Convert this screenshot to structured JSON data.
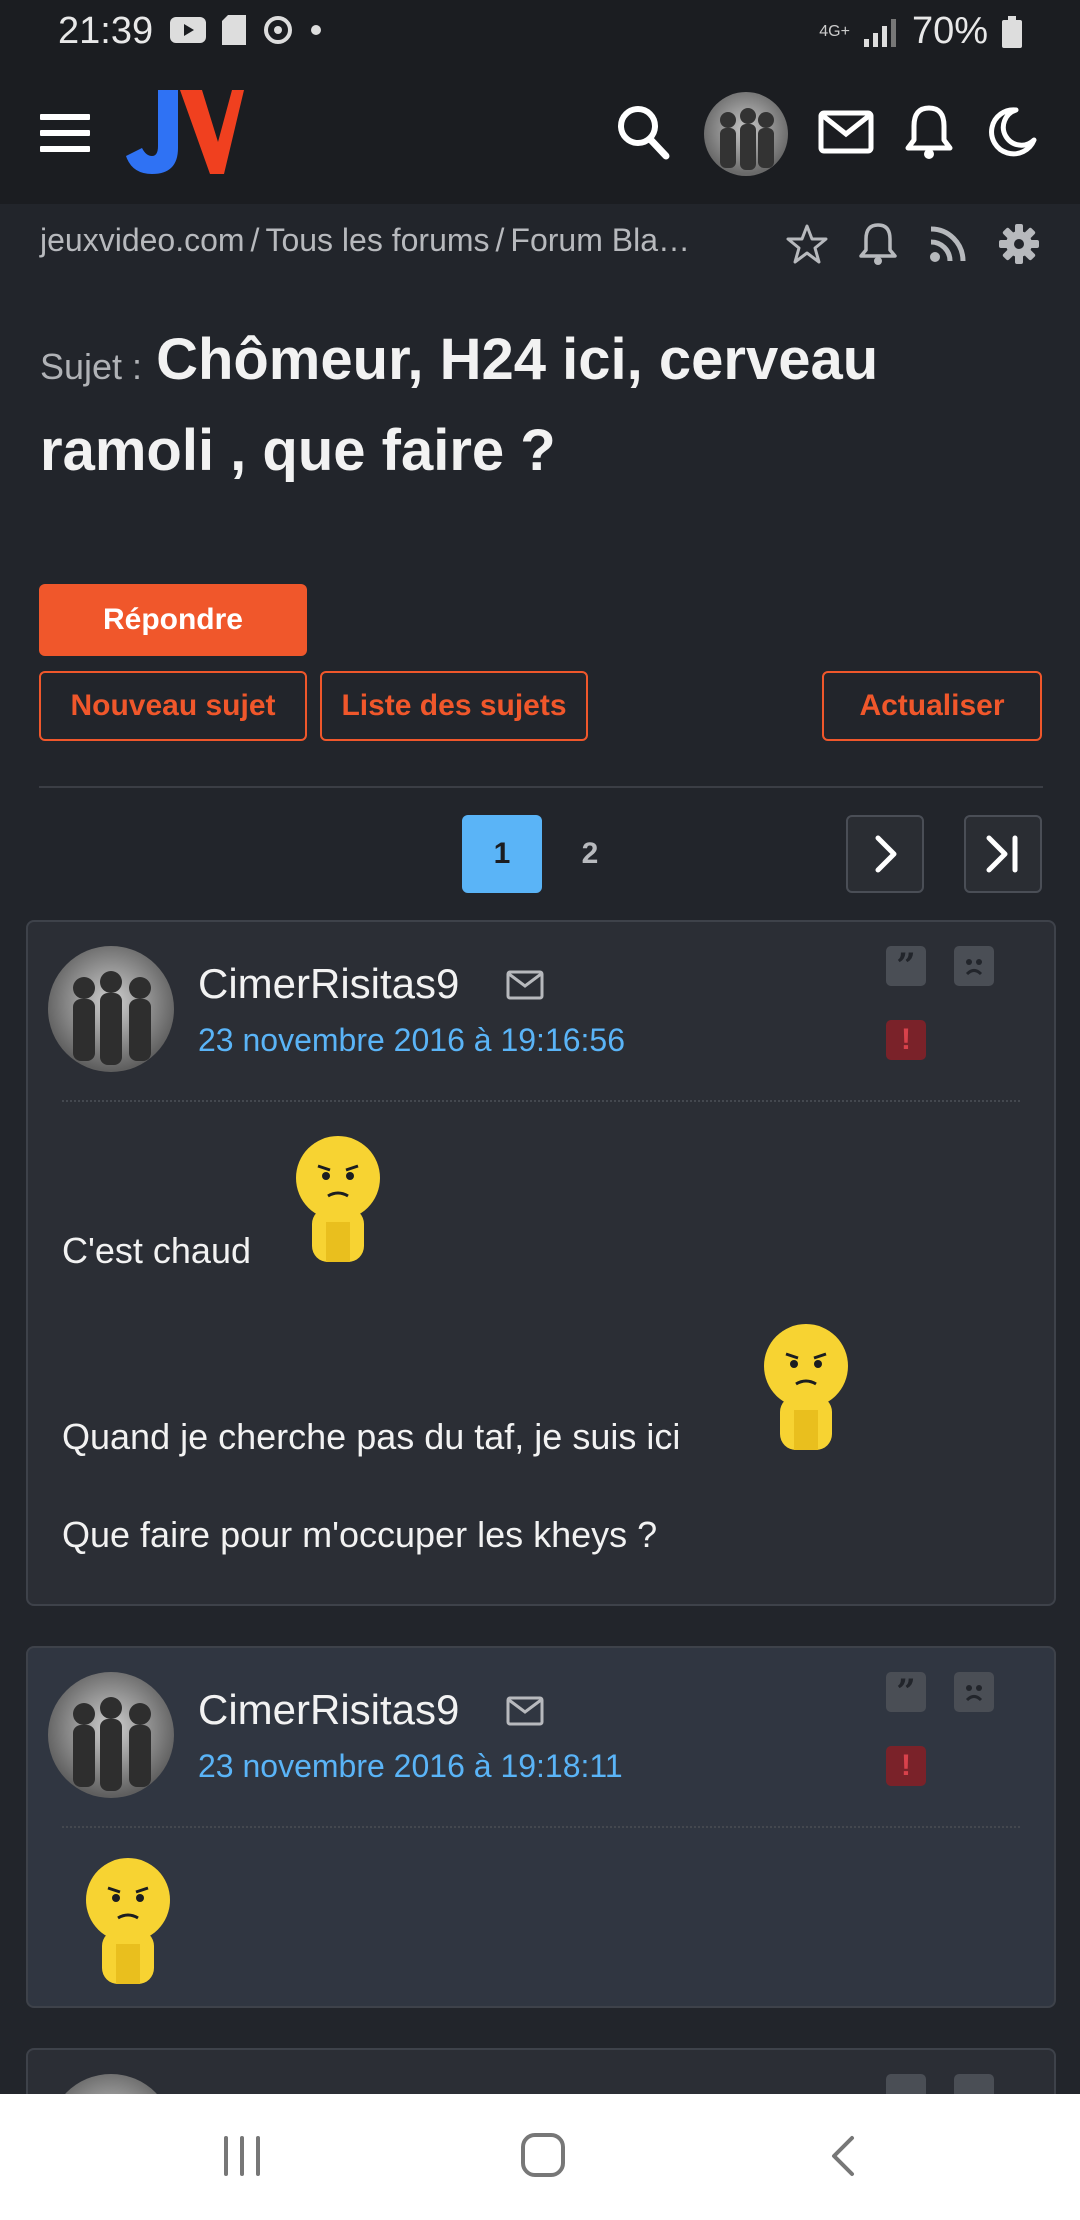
{
  "status_bar": {
    "time": "21:39",
    "network": "4G+",
    "battery": "70%"
  },
  "breadcrumb": {
    "items": [
      "jeuxvideo.com",
      "Tous les forums",
      "Forum Bla…"
    ],
    "separator": "/"
  },
  "topic": {
    "prefix": "Sujet :",
    "title": "Chômeur, H24 ici, cerveau ramoli , que faire ?"
  },
  "buttons": {
    "reply": "Répondre",
    "new_topic": "Nouveau sujet",
    "topic_list": "Liste des sujets",
    "refresh": "Actualiser"
  },
  "pagination": {
    "current": "1",
    "other": "2"
  },
  "posts": [
    {
      "author": "CimerRisitas9",
      "date": "23 novembre 2016 à 19:16:56",
      "lines": [
        "C'est chaud",
        "Quand je cherche pas du taf, je suis ici",
        "Que faire pour m'occuper les kheys ?"
      ]
    },
    {
      "author": "CimerRisitas9",
      "date": "23 novembre 2016 à 19:18:11",
      "lines": []
    }
  ],
  "colors": {
    "accent": "#f0572b",
    "link": "#5ab4f7",
    "background": "#22252b",
    "header": "#1b1d21"
  }
}
